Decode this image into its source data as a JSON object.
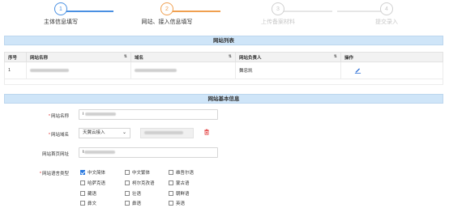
{
  "steps": [
    {
      "num": "1",
      "label": "主体信息填写"
    },
    {
      "num": "2",
      "label": "网站、接入信息填写"
    },
    {
      "num": "3",
      "label": "上传备案材料"
    },
    {
      "num": "4",
      "label": "提交录入"
    }
  ],
  "colors": {
    "done": "#4a90e2",
    "active": "#f0a050",
    "todo": "#d0d0d0",
    "panel_header": "#cfe5f8",
    "checkbox": "#2d7be0",
    "required": "#e03030"
  },
  "site_list": {
    "title": "网站列表",
    "columns": [
      "序号",
      "网站名称",
      "域名",
      "网站负责人",
      "操作"
    ],
    "rows": [
      {
        "index": "1",
        "name": "",
        "domain": "",
        "owner": "舞忠凯",
        "action_icon": "edit-icon"
      }
    ]
  },
  "site_info": {
    "title": "网站基本信息",
    "name_label": "网站名称",
    "name_value": "i ",
    "domain_label": "网站域名",
    "domain_select": "天翼云接入",
    "domain_value": "",
    "homepage_label": "网站首页网址",
    "homepage_value": "t",
    "language_label": "网站语言类型",
    "languages": [
      {
        "label": "中文简体",
        "checked": true
      },
      {
        "label": "中文繁体",
        "checked": false
      },
      {
        "label": "维吾尔语",
        "checked": false
      },
      {
        "label": "哈萨克语",
        "checked": false
      },
      {
        "label": "柯尔克孜语",
        "checked": false
      },
      {
        "label": "蒙古语",
        "checked": false
      },
      {
        "label": "藏语",
        "checked": false
      },
      {
        "label": "壮语",
        "checked": false
      },
      {
        "label": "朝鲜语",
        "checked": false
      },
      {
        "label": "彝文",
        "checked": false
      },
      {
        "label": "彝语",
        "checked": false
      },
      {
        "label": "英语",
        "checked": false
      }
    ]
  }
}
